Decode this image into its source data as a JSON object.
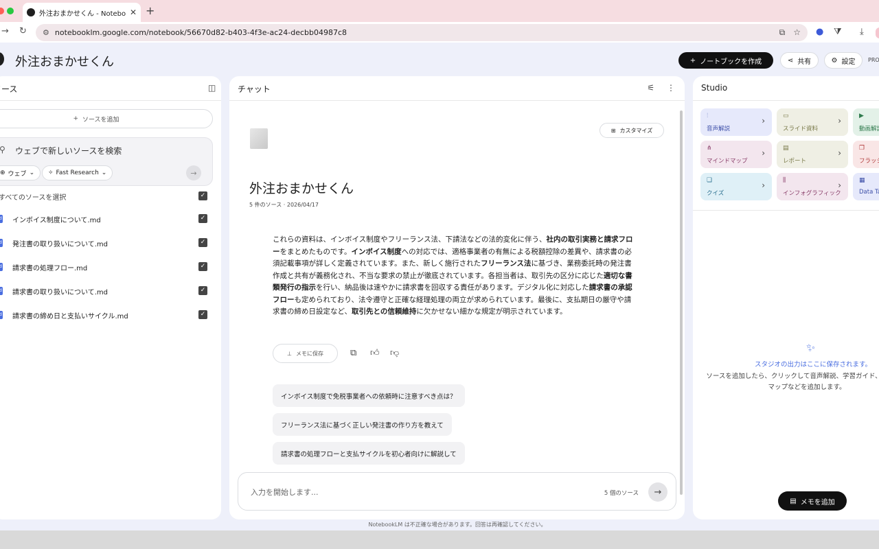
{
  "browser": {
    "tab_title": "外注おまかせくん - NotebookLM",
    "url": "notebooklm.google.com/notebook/56670d82-b403-4f3e-ac24-decbb04987c8"
  },
  "header": {
    "notebook_title": "外注おまかせくん",
    "create_label": "ノートブックを作成",
    "share_label": "共有",
    "settings_label": "設定",
    "pro_badge": "PRO"
  },
  "sources": {
    "title": "ソース",
    "add_label": "ソースを追加",
    "search_placeholder": "ウェブで新しいソースを検索",
    "web_chip": "ウェブ",
    "research_chip": "Fast Research",
    "select_all": "すべてのソースを選択",
    "items": [
      {
        "name": "インボイス制度について.md"
      },
      {
        "name": "発注書の取り扱いについて.md"
      },
      {
        "name": "請求書の処理フロー.md"
      },
      {
        "name": "請求書の取り扱いについて.md"
      },
      {
        "name": "請求書の締め日と支払いサイクル.md"
      }
    ]
  },
  "chat": {
    "title": "チャット",
    "customize_label": "カスタマイズ",
    "notebook_title": "外注おまかせくん",
    "meta": "5 件のソース · 2026/04/17",
    "summary": [
      {
        "t": "これらの資料は、インボイス制度やフリーランス法、下請法などの法的変化に伴う、",
        "b": false
      },
      {
        "t": "社内の取引実務と請求フロー",
        "b": true
      },
      {
        "t": "をまとめたものです。",
        "b": false
      },
      {
        "t": "インボイス制度",
        "b": true
      },
      {
        "t": "への対応では、適格事業者の有無による税額控除の差異や、請求書の必須記載事項が詳しく定義されています。また、新しく施行された",
        "b": false
      },
      {
        "t": "フリーランス法",
        "b": true
      },
      {
        "t": "に基づき、業務委託時の発注書作成と共有が義務化され、不当な要求の禁止が徹底されています。各担当者は、取引先の区分に応じた",
        "b": false
      },
      {
        "t": "適切な書類発行の指示",
        "b": true
      },
      {
        "t": "を行い、納品後は速やかに請求書を回収する責任があります。デジタル化に対応した",
        "b": false
      },
      {
        "t": "請求書の承認フロー",
        "b": true
      },
      {
        "t": "も定められており、法令遵守と正確な経理処理の両立が求められています。最後に、支払期日の厳守や請求書の締め日設定など、",
        "b": false
      },
      {
        "t": "取引先との信頼維持",
        "b": true
      },
      {
        "t": "に欠かせない細かな規定が明示されています。",
        "b": false
      }
    ],
    "save_memo_label": "メモに保存",
    "suggestions": [
      "インボイス制度で免税事業者への依頼時に注意すべき点は？",
      "フリーランス法に基づく正しい発注書の作り方を教えて",
      "請求書の処理フローと支払サイクルを初心者向けに解説して"
    ],
    "input_placeholder": "入力を開始します...",
    "source_count": "5 個のソース",
    "disclaimer": "NotebookLM は不正確な場合があります。回答は再確認してください。"
  },
  "studio": {
    "title": "Studio",
    "tiles": [
      {
        "label": "音声解説",
        "icon": "audio-icon",
        "bg": "#e6e9fb",
        "fg": "#3d4fa8"
      },
      {
        "label": "スライド資料",
        "icon": "slides-icon",
        "bg": "#efefe4",
        "fg": "#7a7a4a"
      },
      {
        "label": "動画解説",
        "icon": "video-icon",
        "bg": "#e3f1e8",
        "fg": "#2f7a4d"
      },
      {
        "label": "マインドマップ",
        "icon": "mindmap-icon",
        "bg": "#f3e6ee",
        "fg": "#8a3e6a"
      },
      {
        "label": "レポート",
        "icon": "report-icon",
        "bg": "#efefe4",
        "fg": "#7a7a4a"
      },
      {
        "label": "フラッシュカード",
        "icon": "flashcard-icon",
        "bg": "#f9e6e6",
        "fg": "#b03a3a"
      },
      {
        "label": "クイズ",
        "icon": "quiz-icon",
        "bg": "#dff0f7",
        "fg": "#2a6f8f"
      },
      {
        "label": "インフォグラフィック",
        "icon": "infographic-icon",
        "bg": "#f3e6ee",
        "fg": "#8a3e6a"
      },
      {
        "label": "Data Table",
        "icon": "table-icon",
        "bg": "#e6e9fb",
        "fg": "#3d4fa8"
      }
    ],
    "empty_title": "スタジオの出力はここに保存されます。",
    "empty_desc": "ソースを追加したら、クリックして音声解説、学習ガイド、マインドマップなどを追加します。",
    "add_memo_label": "メモを追加"
  }
}
